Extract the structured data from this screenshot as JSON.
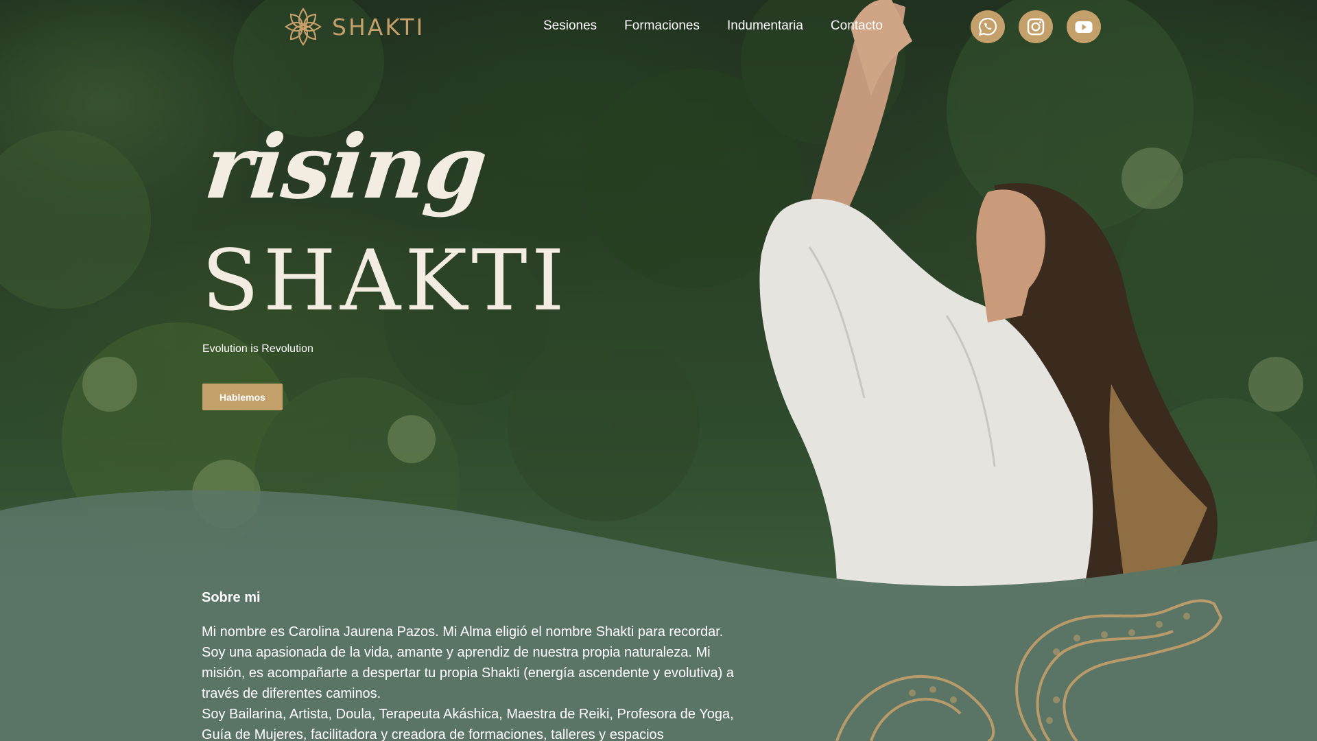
{
  "brand": {
    "logo_text": "SHAKTI",
    "accent_color": "#c4a06a"
  },
  "nav": {
    "items": [
      {
        "label": "Sesiones"
      },
      {
        "label": "Formaciones"
      },
      {
        "label": "Indumentaria"
      },
      {
        "label": "Contacto"
      }
    ]
  },
  "socials": {
    "items": [
      {
        "icon": "whatsapp-icon"
      },
      {
        "icon": "instagram-icon"
      },
      {
        "icon": "youtube-icon"
      }
    ]
  },
  "hero": {
    "title_line1": "rising",
    "title_line2": "SHAKTI",
    "tagline": "Evolution is Revolution",
    "cta_label": "Hablemos"
  },
  "about": {
    "heading": "Sobre mi",
    "paragraph1": "Mi nombre es Carolina Jaurena Pazos. Mi Alma eligió el nombre Shakti para recordar. Soy una apasionada de la vida, amante y aprendiz de nuestra propia naturaleza. Mi misión, es acompañarte a despertar tu propia Shakti (energía ascendente y evolutiva) a través de diferentes caminos.",
    "paragraph2": "Soy Bailarina, Artista, Doula, Terapeuta Akáshica, Maestra de Reiki, Profesora de Yoga, Guía de Mujeres, facilitadora y creadora de formaciones, talleres y espacios"
  }
}
